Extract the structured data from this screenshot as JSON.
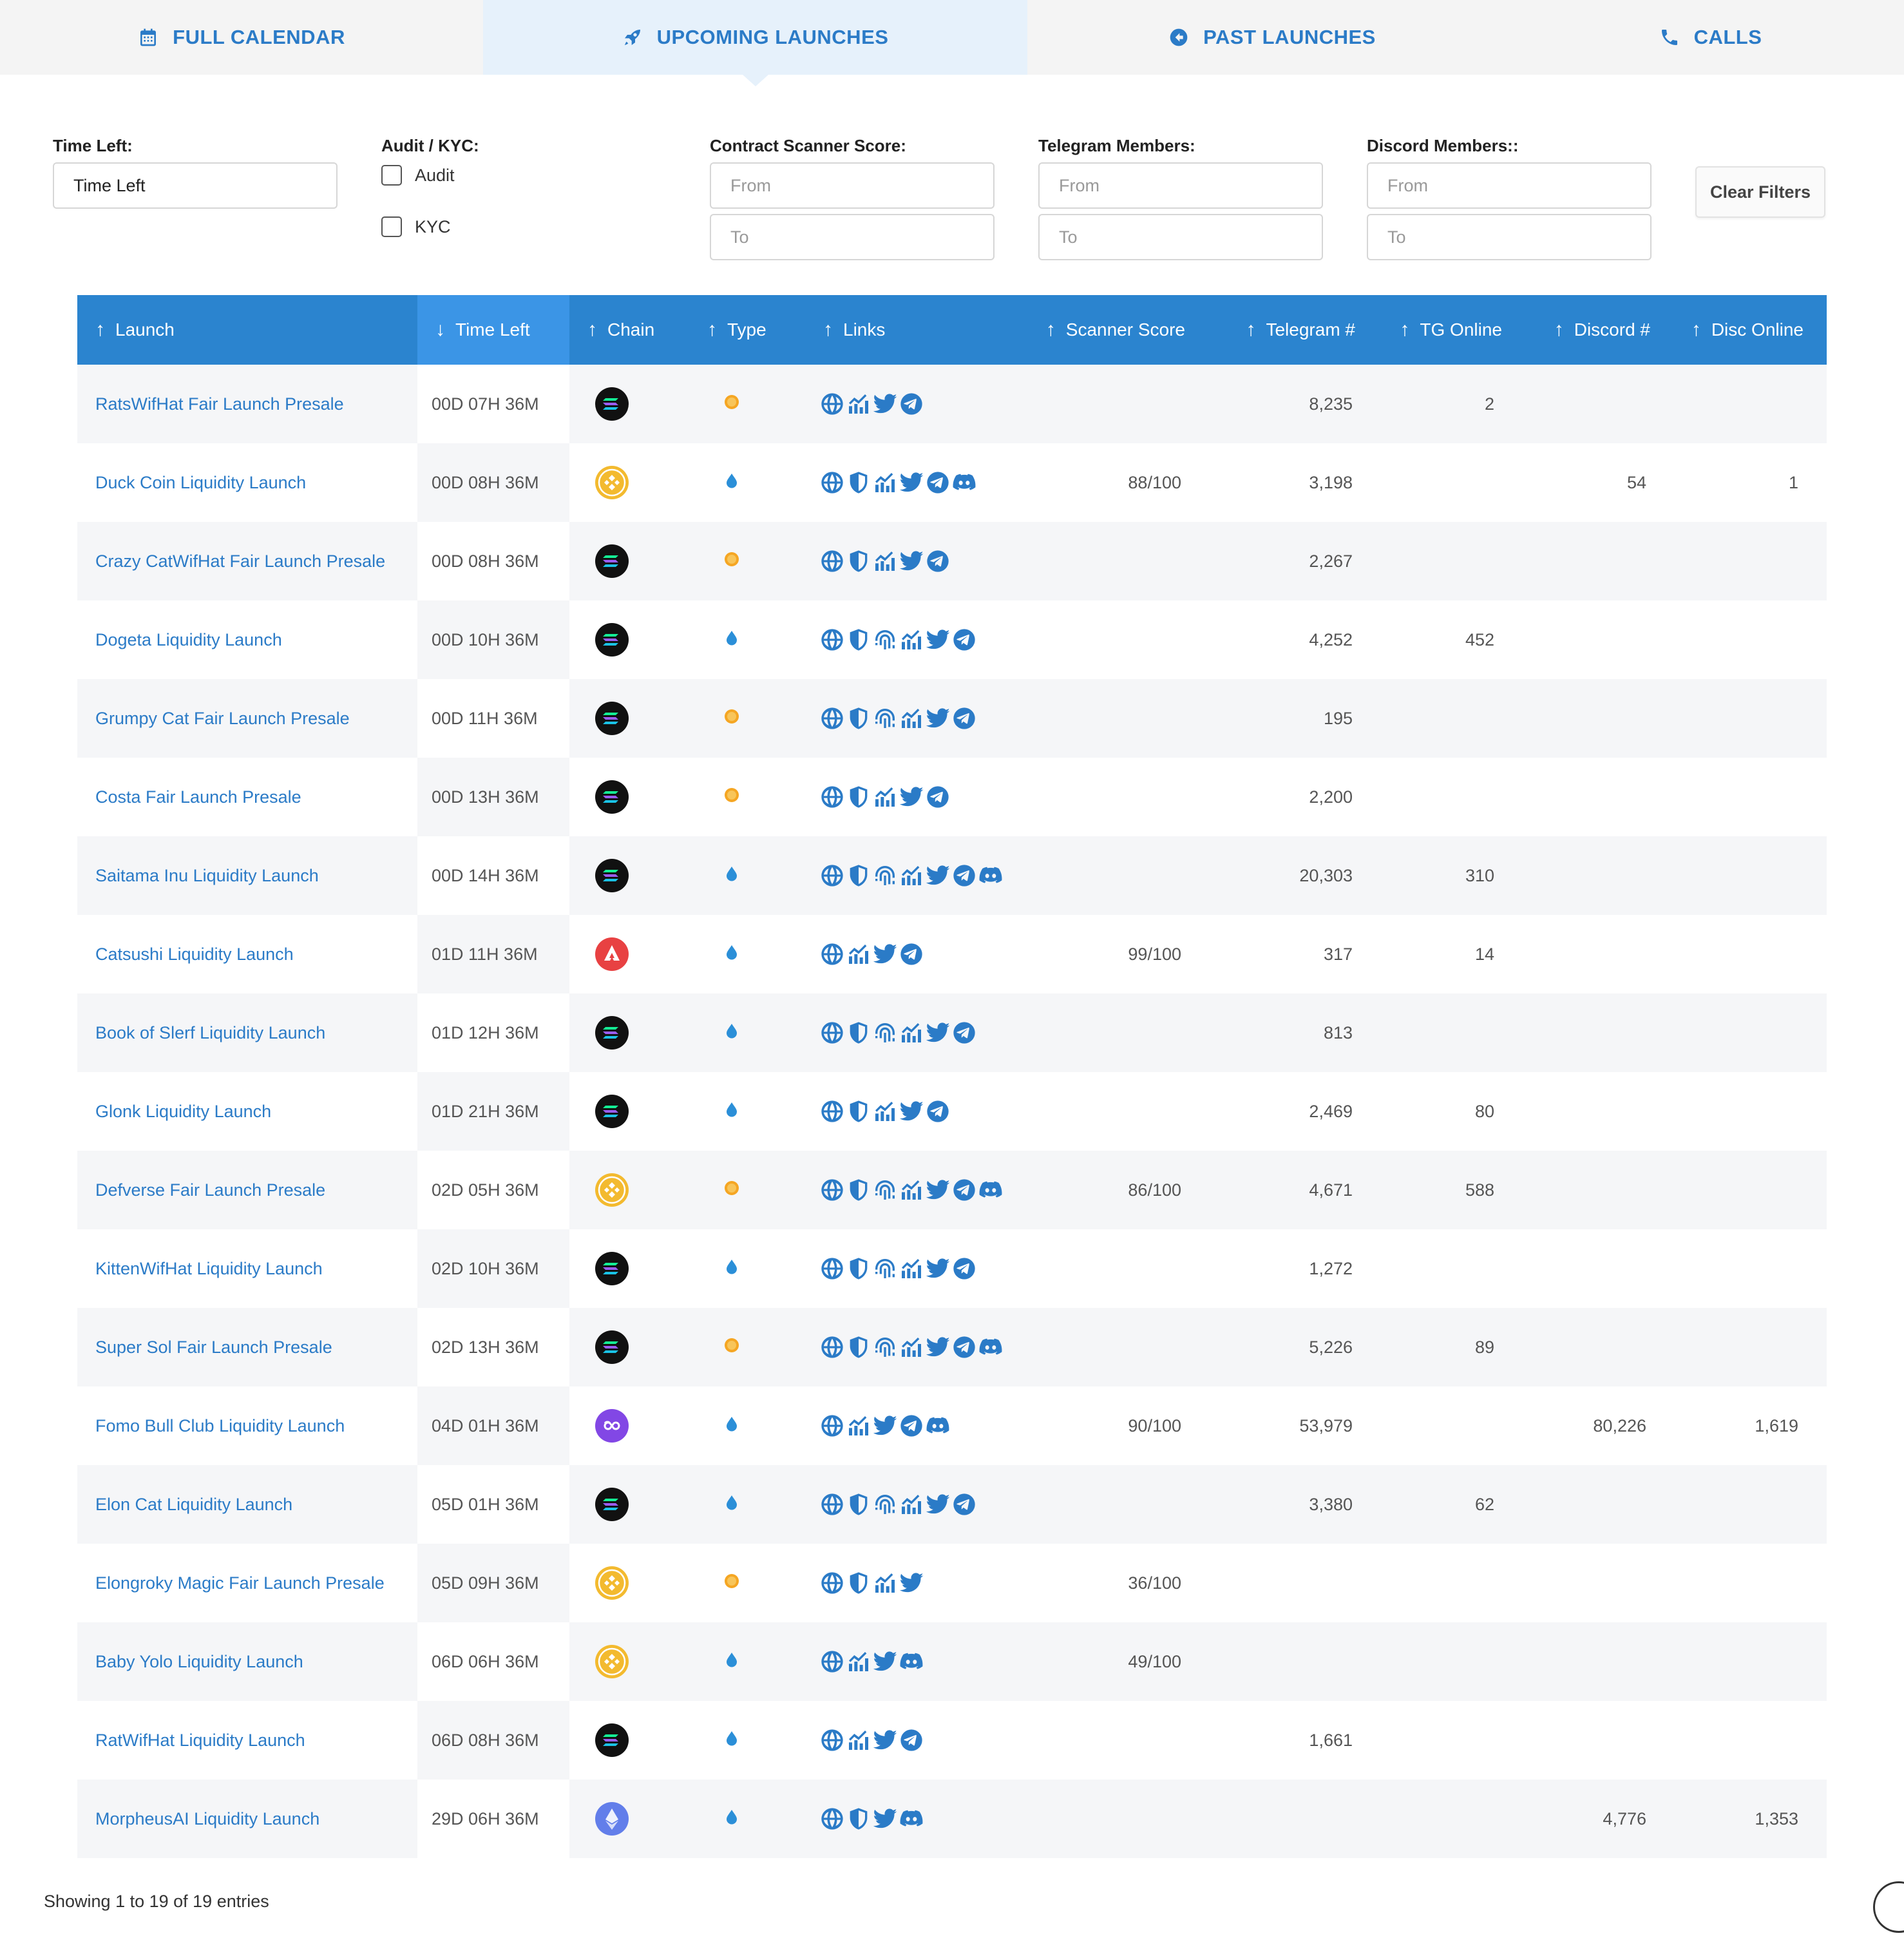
{
  "tabs": [
    {
      "label": "FULL CALENDAR",
      "icon": "calendar-icon",
      "active": false
    },
    {
      "label": "UPCOMING LAUNCHES",
      "icon": "rocket-icon",
      "active": true
    },
    {
      "label": "PAST LAUNCHES",
      "icon": "arrow-left-circle-icon",
      "active": false
    },
    {
      "label": "CALLS",
      "icon": "phone-icon",
      "active": false
    }
  ],
  "filters": {
    "time_left": {
      "label": "Time Left:",
      "value": "Time Left"
    },
    "audit_kyc": {
      "label": "Audit / KYC:",
      "options": [
        "Audit",
        "KYC"
      ]
    },
    "scanner": {
      "label": "Contract Scanner Score:",
      "from_placeholder": "From",
      "to_placeholder": "To"
    },
    "telegram": {
      "label": "Telegram Members:",
      "from_placeholder": "From",
      "to_placeholder": "To"
    },
    "discord": {
      "label": "Discord Members::",
      "from_placeholder": "From",
      "to_placeholder": "To"
    },
    "clear_label": "Clear Filters"
  },
  "table": {
    "columns": [
      "Launch",
      "Time Left",
      "Chain",
      "Type",
      "Links",
      "Scanner Score",
      "Telegram #",
      "TG Online",
      "Discord #",
      "Disc Online"
    ],
    "sorted_column": "Time Left",
    "colors": {
      "header": "#2b84cf",
      "sorted_header": "#3b95e6",
      "link": "#2b7bc7",
      "fair_launch": "#f5a623",
      "liquidity": "#2b8fd8"
    },
    "rows": [
      {
        "launch": "RatsWifHat Fair Launch Presale",
        "time": "00D 07H 36M",
        "chain": "solana",
        "type": "fair",
        "links": [
          "web",
          "chart",
          "twitter",
          "telegram"
        ],
        "score": "",
        "tg": "8,235",
        "tgo": "2",
        "disc": "",
        "disco": ""
      },
      {
        "launch": "Duck Coin Liquidity Launch",
        "time": "00D 08H 36M",
        "chain": "bnb",
        "type": "liquidity",
        "links": [
          "web",
          "shield",
          "chart",
          "twitter",
          "telegram",
          "discord"
        ],
        "score": "88/100",
        "tg": "3,198",
        "tgo": "",
        "disc": "54",
        "disco": "1"
      },
      {
        "launch": "Crazy CatWifHat Fair Launch Presale",
        "time": "00D 08H 36M",
        "chain": "solana",
        "type": "fair",
        "links": [
          "web",
          "shield",
          "chart",
          "twitter",
          "telegram"
        ],
        "score": "",
        "tg": "2,267",
        "tgo": "",
        "disc": "",
        "disco": ""
      },
      {
        "launch": "Dogeta Liquidity Launch",
        "time": "00D 10H 36M",
        "chain": "solana",
        "type": "liquidity",
        "links": [
          "web",
          "shield",
          "fingerprint",
          "chart",
          "twitter",
          "telegram"
        ],
        "score": "",
        "tg": "4,252",
        "tgo": "452",
        "disc": "",
        "disco": ""
      },
      {
        "launch": "Grumpy Cat Fair Launch Presale",
        "time": "00D 11H 36M",
        "chain": "solana",
        "type": "fair",
        "links": [
          "web",
          "shield",
          "fingerprint",
          "chart",
          "twitter",
          "telegram"
        ],
        "score": "",
        "tg": "195",
        "tgo": "",
        "disc": "",
        "disco": ""
      },
      {
        "launch": "Costa Fair Launch Presale",
        "time": "00D 13H 36M",
        "chain": "solana",
        "type": "fair",
        "links": [
          "web",
          "shield",
          "chart",
          "twitter",
          "telegram"
        ],
        "score": "",
        "tg": "2,200",
        "tgo": "",
        "disc": "",
        "disco": ""
      },
      {
        "launch": "Saitama Inu Liquidity Launch",
        "time": "00D 14H 36M",
        "chain": "solana",
        "type": "liquidity",
        "links": [
          "web",
          "shield",
          "fingerprint",
          "chart",
          "twitter",
          "telegram",
          "discord"
        ],
        "score": "",
        "tg": "20,303",
        "tgo": "310",
        "disc": "",
        "disco": ""
      },
      {
        "launch": "Catsushi Liquidity Launch",
        "time": "01D 11H 36M",
        "chain": "avalanche",
        "type": "liquidity",
        "links": [
          "web",
          "chart",
          "twitter",
          "telegram"
        ],
        "score": "99/100",
        "tg": "317",
        "tgo": "14",
        "disc": "",
        "disco": ""
      },
      {
        "launch": "Book of Slerf Liquidity Launch",
        "time": "01D 12H 36M",
        "chain": "solana",
        "type": "liquidity",
        "links": [
          "web",
          "shield",
          "fingerprint",
          "chart",
          "twitter",
          "telegram"
        ],
        "score": "",
        "tg": "813",
        "tgo": "",
        "disc": "",
        "disco": ""
      },
      {
        "launch": "Glonk Liquidity Launch",
        "time": "01D 21H 36M",
        "chain": "solana",
        "type": "liquidity",
        "links": [
          "web",
          "shield",
          "chart",
          "twitter",
          "telegram"
        ],
        "score": "",
        "tg": "2,469",
        "tgo": "80",
        "disc": "",
        "disco": ""
      },
      {
        "launch": "Defverse Fair Launch Presale",
        "time": "02D 05H 36M",
        "chain": "bnb",
        "type": "fair",
        "links": [
          "web",
          "shield",
          "fingerprint",
          "chart",
          "twitter",
          "telegram",
          "discord"
        ],
        "score": "86/100",
        "tg": "4,671",
        "tgo": "588",
        "disc": "",
        "disco": ""
      },
      {
        "launch": "KittenWifHat Liquidity Launch",
        "time": "02D 10H 36M",
        "chain": "solana",
        "type": "liquidity",
        "links": [
          "web",
          "shield",
          "fingerprint",
          "chart",
          "twitter",
          "telegram"
        ],
        "score": "",
        "tg": "1,272",
        "tgo": "",
        "disc": "",
        "disco": ""
      },
      {
        "launch": "Super Sol Fair Launch Presale",
        "time": "02D 13H 36M",
        "chain": "solana",
        "type": "fair",
        "links": [
          "web",
          "shield",
          "fingerprint",
          "chart",
          "twitter",
          "telegram",
          "discord"
        ],
        "score": "",
        "tg": "5,226",
        "tgo": "89",
        "disc": "",
        "disco": ""
      },
      {
        "launch": "Fomo Bull Club Liquidity Launch",
        "time": "04D 01H 36M",
        "chain": "polygon",
        "type": "liquidity",
        "links": [
          "web",
          "chart",
          "twitter",
          "telegram",
          "discord"
        ],
        "score": "90/100",
        "tg": "53,979",
        "tgo": "",
        "disc": "80,226",
        "disco": "1,619"
      },
      {
        "launch": "Elon Cat Liquidity Launch",
        "time": "05D 01H 36M",
        "chain": "solana",
        "type": "liquidity",
        "links": [
          "web",
          "shield",
          "fingerprint",
          "chart",
          "twitter",
          "telegram"
        ],
        "score": "",
        "tg": "3,380",
        "tgo": "62",
        "disc": "",
        "disco": ""
      },
      {
        "launch": "Elongroky Magic Fair Launch Presale",
        "time": "05D 09H 36M",
        "chain": "bnb",
        "type": "fair",
        "links": [
          "web",
          "shield",
          "chart",
          "twitter"
        ],
        "score": "36/100",
        "tg": "",
        "tgo": "",
        "disc": "",
        "disco": ""
      },
      {
        "launch": "Baby Yolo Liquidity Launch",
        "time": "06D 06H 36M",
        "chain": "bnb",
        "type": "liquidity",
        "links": [
          "web",
          "chart",
          "twitter",
          "discord"
        ],
        "score": "49/100",
        "tg": "",
        "tgo": "",
        "disc": "",
        "disco": ""
      },
      {
        "launch": "RatWifHat Liquidity Launch",
        "time": "06D 08H 36M",
        "chain": "solana",
        "type": "liquidity",
        "links": [
          "web",
          "chart",
          "twitter",
          "telegram"
        ],
        "score": "",
        "tg": "1,661",
        "tgo": "",
        "disc": "",
        "disco": ""
      },
      {
        "launch": "MorpheusAI Liquidity Launch",
        "time": "29D 06H 36M",
        "chain": "ethereum",
        "type": "liquidity",
        "links": [
          "web",
          "shield",
          "twitter",
          "discord"
        ],
        "score": "",
        "tg": "",
        "tgo": "",
        "disc": "4,776",
        "disco": "1,353"
      }
    ]
  },
  "footer": {
    "info": "Showing 1 to 19 of 19 entries"
  }
}
